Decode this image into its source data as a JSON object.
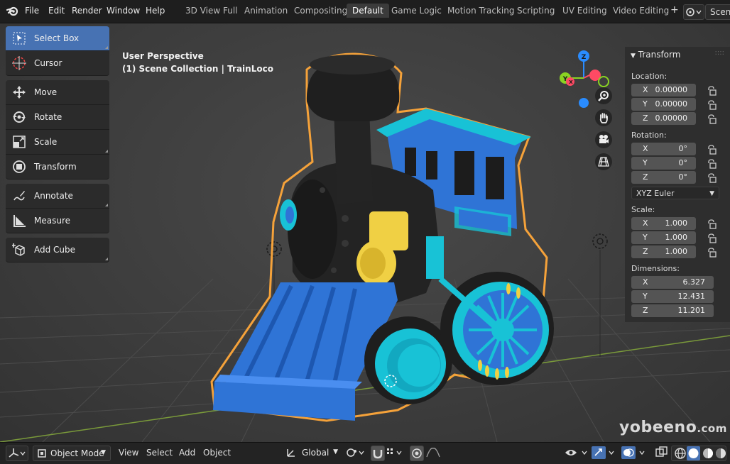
{
  "menu": {
    "file": "File",
    "edit": "Edit",
    "render": "Render",
    "window": "Window",
    "help": "Help"
  },
  "tabs": [
    "3D View Full",
    "Animation",
    "Compositing",
    "Default",
    "Game Logic",
    "Motion Tracking",
    "Scripting",
    "UV Editing",
    "Video Editing"
  ],
  "active_tab": "Default",
  "add_tab": "+",
  "scene_label": "Scene",
  "viewport": {
    "title": "User Perspective",
    "subtitle": "(1) Scene Collection | TrainLoco"
  },
  "tools": [
    {
      "label": "Select Box",
      "icon": "select-box-icon"
    },
    {
      "label": "Cursor",
      "icon": "cursor-icon"
    },
    {
      "label": "Move",
      "icon": "move-icon"
    },
    {
      "label": "Rotate",
      "icon": "rotate-icon"
    },
    {
      "label": "Scale",
      "icon": "scale-icon"
    },
    {
      "label": "Transform",
      "icon": "transform-icon"
    },
    {
      "label": "Annotate",
      "icon": "annotate-icon"
    },
    {
      "label": "Measure",
      "icon": "measure-icon"
    },
    {
      "label": "Add Cube",
      "icon": "add-cube-icon"
    }
  ],
  "gizmo": {
    "z": "Z",
    "y": "Y",
    "x": "X"
  },
  "transform": {
    "header": "Transform",
    "location_label": "Location:",
    "location": [
      {
        "axis": "X",
        "value": "0.00000"
      },
      {
        "axis": "Y",
        "value": "0.00000"
      },
      {
        "axis": "Z",
        "value": "0.00000"
      }
    ],
    "rotation_label": "Rotation:",
    "rotation": [
      {
        "axis": "X",
        "value": "0°"
      },
      {
        "axis": "Y",
        "value": "0°"
      },
      {
        "axis": "Z",
        "value": "0°"
      }
    ],
    "rotation_mode": "XYZ Euler",
    "scale_label": "Scale:",
    "scale": [
      {
        "axis": "X",
        "value": "1.000"
      },
      {
        "axis": "Y",
        "value": "1.000"
      },
      {
        "axis": "Z",
        "value": "1.000"
      }
    ],
    "dimensions_label": "Dimensions:",
    "dimensions": [
      {
        "axis": "X",
        "value": "6.327"
      },
      {
        "axis": "Y",
        "value": "12.431"
      },
      {
        "axis": "Z",
        "value": "11.201"
      }
    ]
  },
  "bottom": {
    "mode": "Object Mode",
    "view": "View",
    "select": "Select",
    "add": "Add",
    "object": "Object",
    "orientation": "Global"
  },
  "watermark": {
    "main": "yobeeno",
    "suffix": ".com"
  },
  "colors": {
    "accent": "#4772b3",
    "selection_outline": "#f5a23a",
    "train_blue": "#2f74d6",
    "train_cyan": "#18c2d6",
    "train_yellow": "#f0d044",
    "train_black": "#232323"
  }
}
